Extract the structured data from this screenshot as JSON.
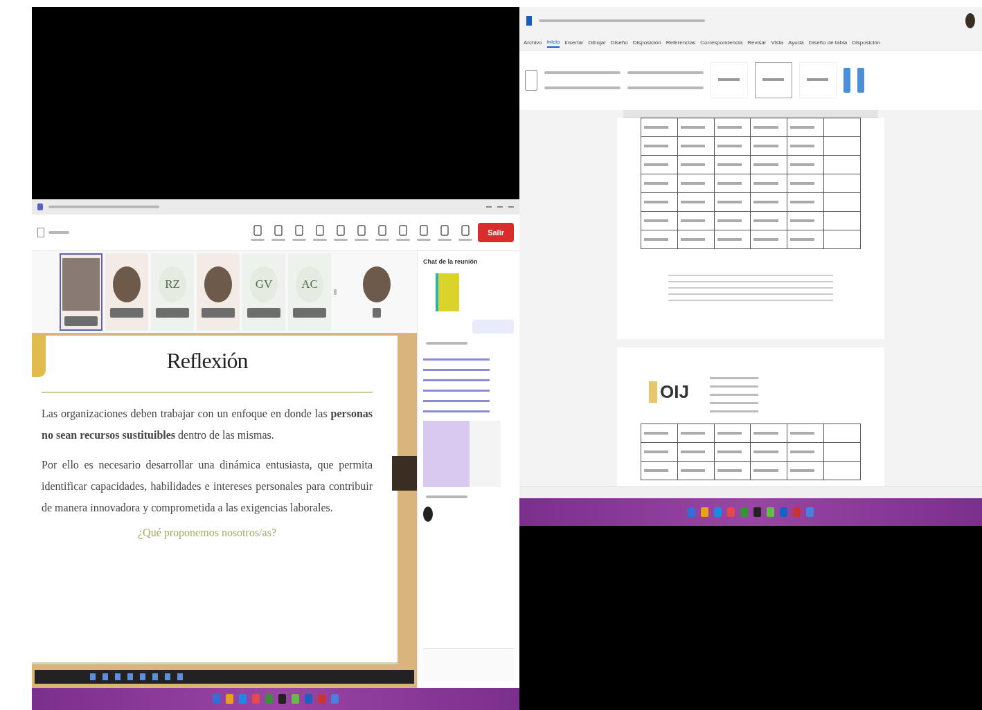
{
  "meeting": {
    "leave_button": {
      "label": "Salir"
    },
    "participants": [
      {
        "kind": "video",
        "selected": true
      },
      {
        "kind": "photo",
        "selected": false
      },
      {
        "kind": "initials",
        "initials": "RZ",
        "selected": false
      },
      {
        "kind": "photo",
        "selected": false
      },
      {
        "kind": "initials",
        "initials": "GV",
        "selected": false
      },
      {
        "kind": "initials",
        "initials": "AC",
        "selected": false
      }
    ],
    "slide": {
      "title": "Reflexión",
      "bullets": [
        "Las organizaciones deben trabajar con un enfoque en donde las **personas no sean recursos sustituibles** dentro de las mismas.",
        "Por ello es necesario desarrollar una dinámica entusiasta, que permita identificar capacidades, habilidades e intereses personales para contribuir de manera innovadora y comprometida a las exigencias laborales."
      ],
      "question": "¿Qué proponemos nosotros/as?"
    },
    "chat": {
      "title": "Chat de la reunión"
    }
  },
  "word": {
    "tabs": [
      {
        "label": "Archivo",
        "selected": false
      },
      {
        "label": "Inicio",
        "selected": true
      },
      {
        "label": "Insertar",
        "selected": false
      },
      {
        "label": "Dibujar",
        "selected": false
      },
      {
        "label": "Diseño",
        "selected": false
      },
      {
        "label": "Disposición",
        "selected": false
      },
      {
        "label": "Referencias",
        "selected": false
      },
      {
        "label": "Correspondencia",
        "selected": false
      },
      {
        "label": "Revisar",
        "selected": false
      },
      {
        "label": "Vista",
        "selected": false
      },
      {
        "label": "Ayuda",
        "selected": false
      },
      {
        "label": "Diseño de tabla",
        "selected": false
      },
      {
        "label": "Disposición",
        "selected": false
      }
    ],
    "logo": "OIJ"
  }
}
